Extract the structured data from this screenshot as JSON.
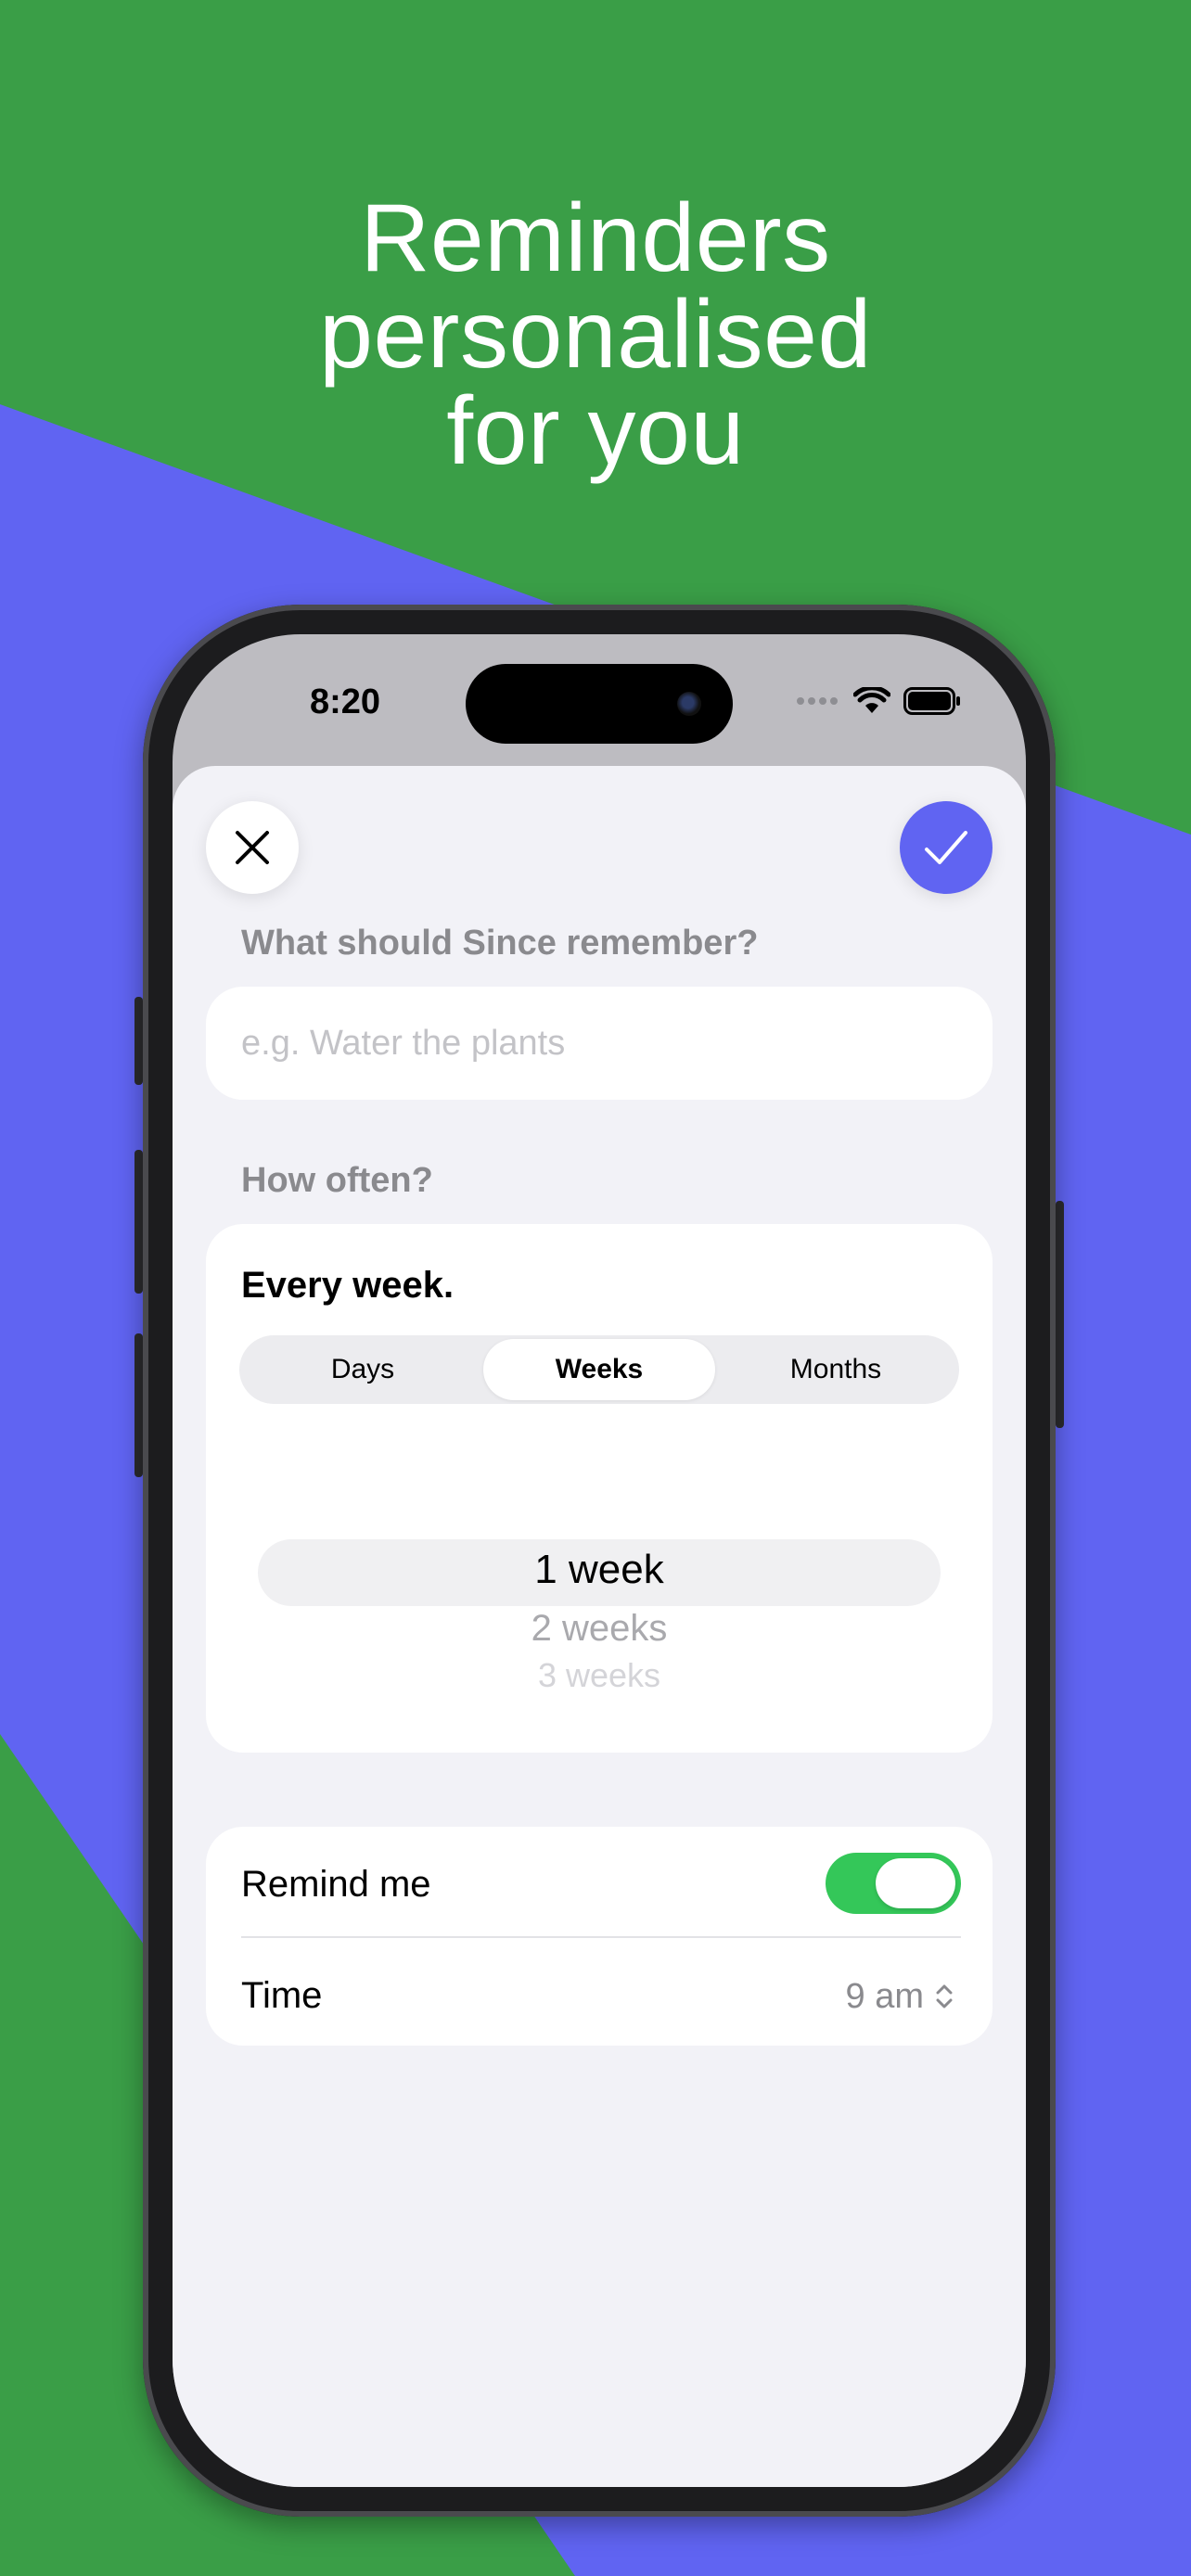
{
  "headline": {
    "lines": [
      "Reminders",
      "personalised",
      "for you"
    ]
  },
  "colors": {
    "green": "#3a9e47",
    "purple": "#6064f2",
    "toggle_on": "#34c759"
  },
  "status_bar": {
    "time": "8:20",
    "icons": [
      "signal-dots-icon",
      "wifi-icon",
      "battery-icon"
    ]
  },
  "sheet": {
    "close_icon": "close-icon",
    "done_icon": "checkmark-icon",
    "question_label": "What should Since remember?",
    "reminder_input": {
      "value": "",
      "placeholder": "e.g. Water the plants"
    },
    "frequency_label": "How often?",
    "frequency": {
      "summary": "Every week.",
      "units": [
        "Days",
        "Weeks",
        "Months"
      ],
      "selected_unit": "Weeks",
      "picker_items": [
        "1 week",
        "2 weeks",
        "3 weeks"
      ],
      "picker_selected": "1 week"
    },
    "remind_me": {
      "label": "Remind me",
      "enabled": true
    },
    "time": {
      "label": "Time",
      "value": "9 am"
    }
  }
}
